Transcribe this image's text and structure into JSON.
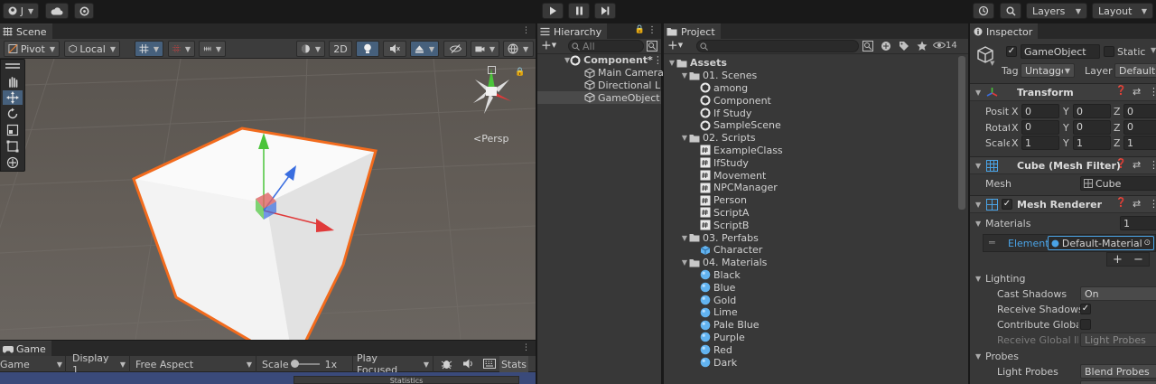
{
  "topbar": {
    "account_label": "J",
    "layers_label": "Layers",
    "layout_label": "Layout"
  },
  "scene": {
    "tab_label": "Scene",
    "pivot_label": "Pivot",
    "local_label": "Local",
    "mode_2d_label": "2D",
    "persp_label": "Persp"
  },
  "game": {
    "tab_label": "Game",
    "game_dropdown": "Game",
    "display_dropdown": "Display 1",
    "aspect_dropdown": "Free Aspect",
    "scale_label": "Scale",
    "scale_value": "1x",
    "play_focused_dropdown": "Play Focused",
    "stats_label": "Stats",
    "statistics_label": "Statistics"
  },
  "hierarchy": {
    "tab_label": "Hierarchy",
    "search_placeholder": "All",
    "scene_name": "Component*",
    "items": [
      {
        "label": "Main Camera"
      },
      {
        "label": "Directional Light"
      },
      {
        "label": "GameObject"
      }
    ]
  },
  "project": {
    "tab_label": "Project",
    "hidden_count": "14",
    "root_label": "Assets",
    "folders": [
      {
        "label": "01. Scenes",
        "icon": "unity-scene-icon",
        "items": [
          "among",
          "Component",
          "If Study",
          "SampleScene"
        ]
      },
      {
        "label": "02. Scripts",
        "icon": "csharp-script-icon",
        "items": [
          "ExampleClass",
          "IfStudy",
          "Movement",
          "NPCManager",
          "Person",
          "ScriptA",
          "ScriptB"
        ]
      },
      {
        "label": "03. Perfabs",
        "icon": "prefab-icon",
        "items": [
          "Character"
        ]
      },
      {
        "label": "04. Materials",
        "icon": "material-icon",
        "items": [
          "Black",
          "Blue",
          "Gold",
          "Lime",
          "Pale Blue",
          "Purple",
          "Red",
          "Dark"
        ]
      }
    ]
  },
  "inspector": {
    "tab_label": "Inspector",
    "object_name": "GameObject",
    "static_label": "Static",
    "tag_label": "Tag",
    "tag_value": "Untagged",
    "layer_label": "Layer",
    "layer_value": "Default",
    "transform": {
      "title": "Transform",
      "rows": [
        {
          "label": "Position",
          "x": "0",
          "y": "0",
          "z": "0"
        },
        {
          "label": "Rotation",
          "x": "0",
          "y": "0",
          "z": "0"
        },
        {
          "label": "Scale",
          "x": "1",
          "y": "1",
          "z": "1"
        }
      ],
      "axis_x": "X",
      "axis_y": "Y",
      "axis_z": "Z"
    },
    "mesh_filter": {
      "title": "Cube (Mesh Filter)",
      "mesh_label": "Mesh",
      "mesh_value": "Cube"
    },
    "mesh_renderer": {
      "title": "Mesh Renderer",
      "materials_label": "Materials",
      "materials_count": "1",
      "element_label": "Element",
      "element_value": "Default-Material",
      "add_label": "+",
      "remove_label": "−",
      "lighting_label": "Lighting",
      "cast_shadows_label": "Cast Shadows",
      "cast_shadows_value": "On",
      "receive_shadows_label": "Receive Shadows",
      "contribute_gi_label": "Contribute Global Illumination",
      "receive_gi_label": "Receive Global Illumination",
      "receive_gi_value": "Light Probes",
      "probes_label": "Probes",
      "light_probes_label": "Light Probes",
      "light_probes_value": "Blend Probes"
    }
  },
  "colors": {
    "selection_outline": "#f26b1d",
    "accent_blue": "#4aa3e6",
    "gizmo_x": "#e03a3a",
    "gizmo_y": "#4ac43a",
    "gizmo_z": "#3a6ee0"
  }
}
